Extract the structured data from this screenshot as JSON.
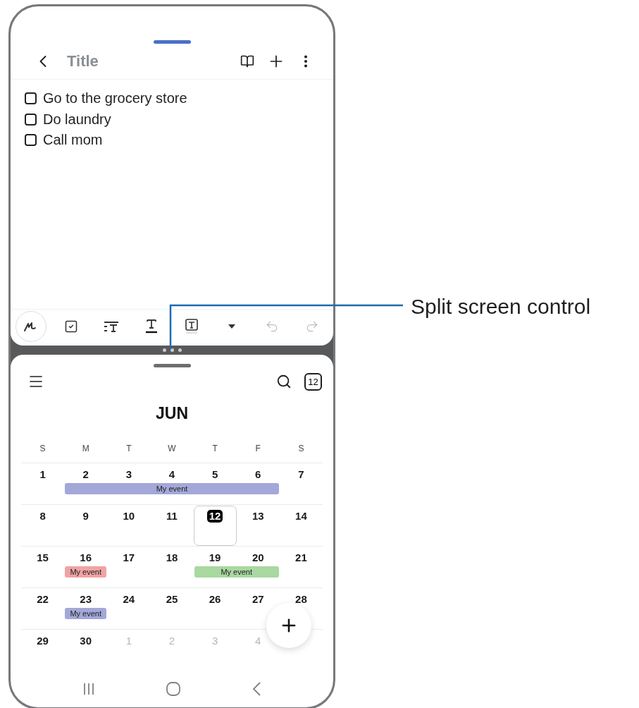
{
  "callout": {
    "label": "Split screen control"
  },
  "notes": {
    "title": "Title",
    "checklist": [
      {
        "label": "Go to the grocery store",
        "checked": false
      },
      {
        "label": "Do laundry",
        "checked": false
      },
      {
        "label": "Call mom",
        "checked": false
      }
    ]
  },
  "calendar": {
    "date_icon": "12",
    "month": "JUN",
    "weekdays": [
      "S",
      "M",
      "T",
      "W",
      "T",
      "F",
      "S"
    ],
    "weeks": [
      {
        "days": [
          {
            "label": "1",
            "faded": false,
            "today": false
          },
          {
            "label": "2",
            "faded": false,
            "today": false,
            "event": {
              "label": "My event",
              "color": "#a3a8d8"
            }
          },
          {
            "label": "3",
            "faded": false,
            "today": false,
            "event": {
              "color": "#a3a8d8"
            }
          },
          {
            "label": "4",
            "faded": false,
            "today": false,
            "event": {
              "color": "#a3a8d8"
            }
          },
          {
            "label": "5",
            "faded": false,
            "today": false,
            "event": {
              "color": "#a3a8d8"
            }
          },
          {
            "label": "6",
            "faded": false,
            "today": false,
            "event": {
              "color": "#a3a8d8"
            }
          },
          {
            "label": "7",
            "faded": false,
            "today": false
          }
        ]
      },
      {
        "days": [
          {
            "label": "8",
            "faded": false,
            "today": false
          },
          {
            "label": "9",
            "faded": false,
            "today": false
          },
          {
            "label": "10",
            "faded": false,
            "today": false
          },
          {
            "label": "11",
            "faded": false,
            "today": false
          },
          {
            "label": "12",
            "faded": false,
            "today": true
          },
          {
            "label": "13",
            "faded": false,
            "today": false
          },
          {
            "label": "14",
            "faded": false,
            "today": false
          }
        ]
      },
      {
        "days": [
          {
            "label": "15",
            "faded": false,
            "today": false
          },
          {
            "label": "16",
            "faded": false,
            "today": false,
            "event": {
              "label": "My event",
              "color": "#f0a3a3"
            }
          },
          {
            "label": "17",
            "faded": false,
            "today": false
          },
          {
            "label": "18",
            "faded": false,
            "today": false
          },
          {
            "label": "19",
            "faded": false,
            "today": false,
            "event": {
              "label": "My event",
              "color": "#a9d8a0"
            }
          },
          {
            "label": "20",
            "faded": false,
            "today": false,
            "event": {
              "color": "#a9d8a0"
            }
          },
          {
            "label": "21",
            "faded": false,
            "today": false
          }
        ]
      },
      {
        "days": [
          {
            "label": "22",
            "faded": false,
            "today": false
          },
          {
            "label": "23",
            "faded": false,
            "today": false,
            "event": {
              "label": "My event",
              "color": "#a3a8d8"
            }
          },
          {
            "label": "24",
            "faded": false,
            "today": false
          },
          {
            "label": "25",
            "faded": false,
            "today": false
          },
          {
            "label": "26",
            "faded": false,
            "today": false
          },
          {
            "label": "27",
            "faded": false,
            "today": false
          },
          {
            "label": "28",
            "faded": false,
            "today": false
          }
        ]
      },
      {
        "days": [
          {
            "label": "29",
            "faded": false,
            "today": false
          },
          {
            "label": "30",
            "faded": false,
            "today": false
          },
          {
            "label": "1",
            "faded": true,
            "today": false
          },
          {
            "label": "2",
            "faded": true,
            "today": false
          },
          {
            "label": "3",
            "faded": true,
            "today": false
          },
          {
            "label": "4",
            "faded": true,
            "today": false
          }
        ]
      }
    ]
  }
}
